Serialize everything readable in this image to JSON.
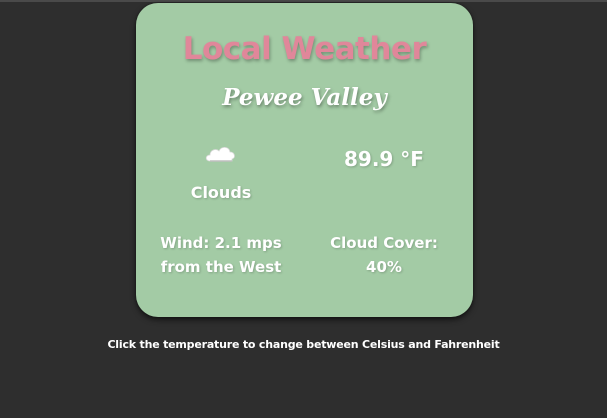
{
  "card": {
    "title": "Local Weather",
    "location": "Pewee Valley",
    "condition_icon": "cloud-icon",
    "condition": "Clouds",
    "temperature": "89.9 °F",
    "wind_line1": "Wind: 2.1 mps",
    "wind_line2": "from the West",
    "cover_line1": "Cloud Cover:",
    "cover_line2": "40%"
  },
  "hint": "Click the temperature to change between Celsius and Fahrenheit",
  "colors": {
    "background": "#2e2e2e",
    "card": "#a3cba5",
    "title": "#e0879a",
    "text": "#ffffff"
  }
}
